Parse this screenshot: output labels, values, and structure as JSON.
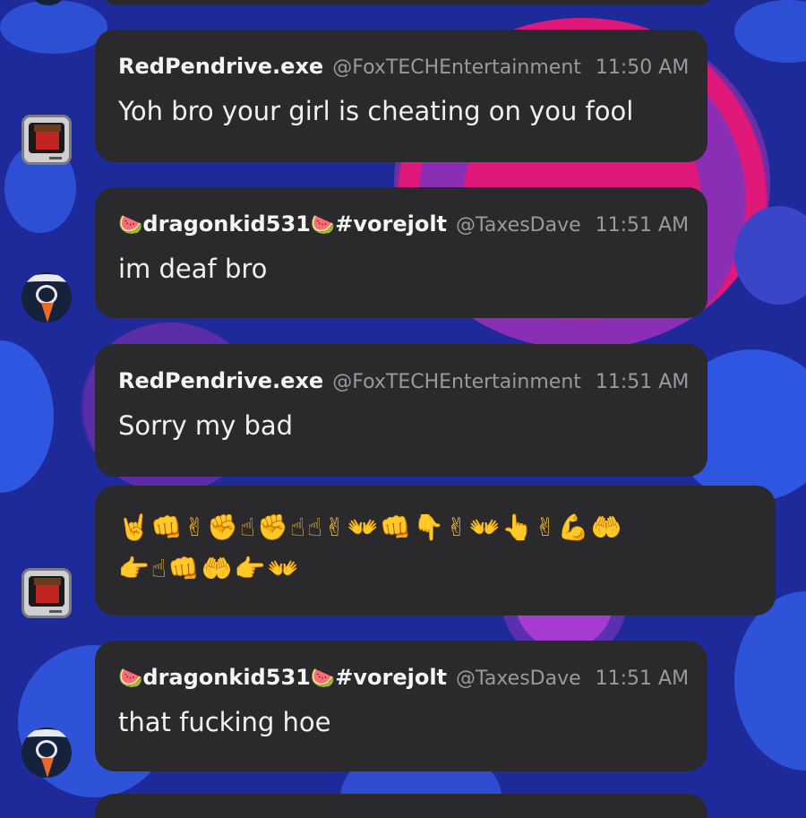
{
  "messages": [
    {
      "author": "RedPendrive.exe",
      "handle": "@FoxTECHEntertainment",
      "time": "11:50 AM",
      "text": "Yoh bro your girl is cheating on you fool",
      "avatar": "tv-avatar"
    },
    {
      "author_prefix": "🍉",
      "author_name": "dragonkid531",
      "author_mid": "🍉",
      "author_suffix": "#vorejolt",
      "handle": "@TaxesDave",
      "time": "11:51 AM",
      "text": "im deaf bro",
      "avatar": "fox-avatar"
    },
    {
      "author": "RedPendrive.exe",
      "handle": "@FoxTECHEntertainment",
      "time": "11:51 AM",
      "text": "Sorry my bad"
    },
    {
      "emoji_line_1": "🤘👊✌✊☝✊☝☝✌👐👊👇✌👐👆✌💪🤲",
      "emoji_line_2": "👉☝👊🤲👉👐",
      "avatar": "tv-avatar"
    },
    {
      "author_prefix": "🍉",
      "author_name": "dragonkid531",
      "author_mid": "🍉",
      "author_suffix": "#vorejolt",
      "handle": "@TaxesDave",
      "time": "11:51 AM",
      "text": "that fucking hoe",
      "avatar": "fox-avatar"
    }
  ],
  "colors": {
    "background": "#1f2a9a",
    "bubble": "#2a2a2c",
    "author_text": "#f4f4f4",
    "meta_text": "#9a9a9e"
  }
}
